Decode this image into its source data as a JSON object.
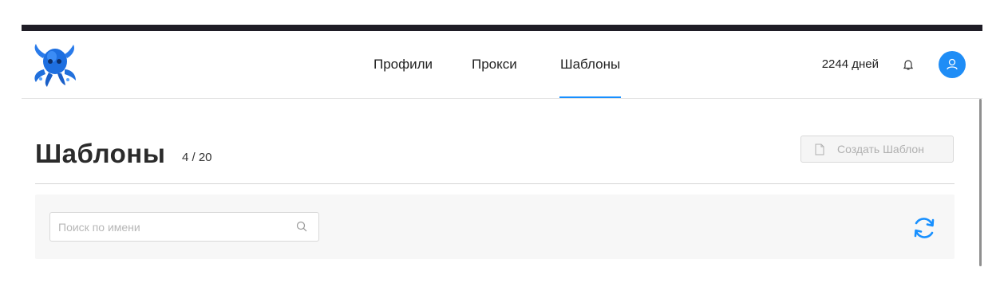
{
  "header": {
    "nav": [
      {
        "label": "Профили"
      },
      {
        "label": "Прокси"
      },
      {
        "label": "Шаблоны",
        "active": true
      }
    ],
    "days_left": "2244 дней"
  },
  "page": {
    "title": "Шаблоны",
    "count": "4 / 20",
    "create_button_label": "Создать Шаблон"
  },
  "toolbar": {
    "search_placeholder": "Поиск по имени",
    "search_value": ""
  },
  "colors": {
    "accent": "#1890ff",
    "topbar": "#1f1d26",
    "toolbar_bg": "#f7f7f7"
  },
  "icons": {
    "logo": "octopus-logo-icon",
    "bell": "bell-icon",
    "avatar": "user-icon",
    "file": "file-icon",
    "search": "search-icon",
    "refresh": "refresh-icon"
  }
}
